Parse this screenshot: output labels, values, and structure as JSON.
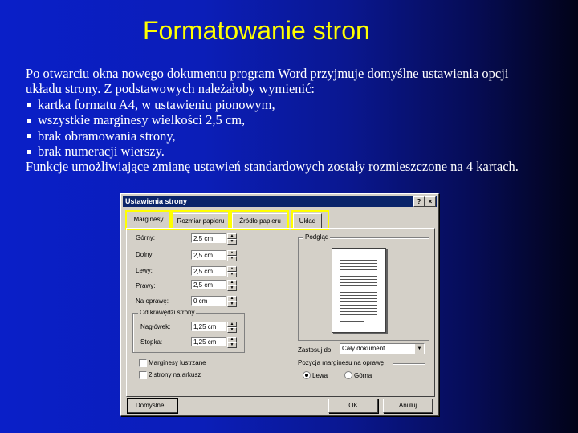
{
  "slide": {
    "title": "Formatowanie stron",
    "paragraph_line1": "Po otwarciu okna nowego dokumentu program Word przyjmuje domyślne ustawienia opcji",
    "paragraph_line2": "układu strony.  Z podstawowych należałoby wymienić:",
    "bullets": [
      "kartka formatu A4, w ustawieniu pionowym,",
      "wszystkie marginesy wielkości 2,5 cm,",
      "brak obramowania strony,",
      "brak numeracji wierszy."
    ],
    "closing": "Funkcje umożliwiające zmianę ustawień standardowych zostały rozmieszczone na 4 kartach."
  },
  "dialog": {
    "title": "Ustawienia strony",
    "help_button": "?",
    "close_button": "×",
    "tabs": [
      "Marginesy",
      "Rozmiar papieru",
      "Źródło papieru",
      "Układ"
    ],
    "fields": {
      "top": {
        "label": "Górny:",
        "value": "2,5 cm"
      },
      "bottom": {
        "label": "Dolny:",
        "value": "2,5 cm"
      },
      "left": {
        "label": "Lewy:",
        "value": "2,5 cm"
      },
      "right": {
        "label": "Prawy:",
        "value": "2,5 cm"
      },
      "gutter": {
        "label": "Na oprawę:",
        "value": "0 cm"
      }
    },
    "edge_group": {
      "title": "Od krawędzi strony",
      "header": {
        "label": "Nagłówek:",
        "value": "1,25 cm"
      },
      "footer": {
        "label": "Stopka:",
        "value": "1,25 cm"
      }
    },
    "checkboxes": [
      "Marginesy lustrzane",
      "2 strony na arkusz"
    ],
    "preview_label": "Podgląd",
    "apply_to": {
      "label": "Zastosuj do:",
      "value": "Cały dokument"
    },
    "gutter_position": {
      "label": "Pozycja marginesu na oprawę",
      "options": [
        "Lewa",
        "Górna"
      ],
      "selected": "Lewa"
    },
    "buttons": {
      "default": "Domyślne...",
      "ok": "OK",
      "cancel": "Anuluj"
    },
    "highlight_color": "#ffff00"
  }
}
